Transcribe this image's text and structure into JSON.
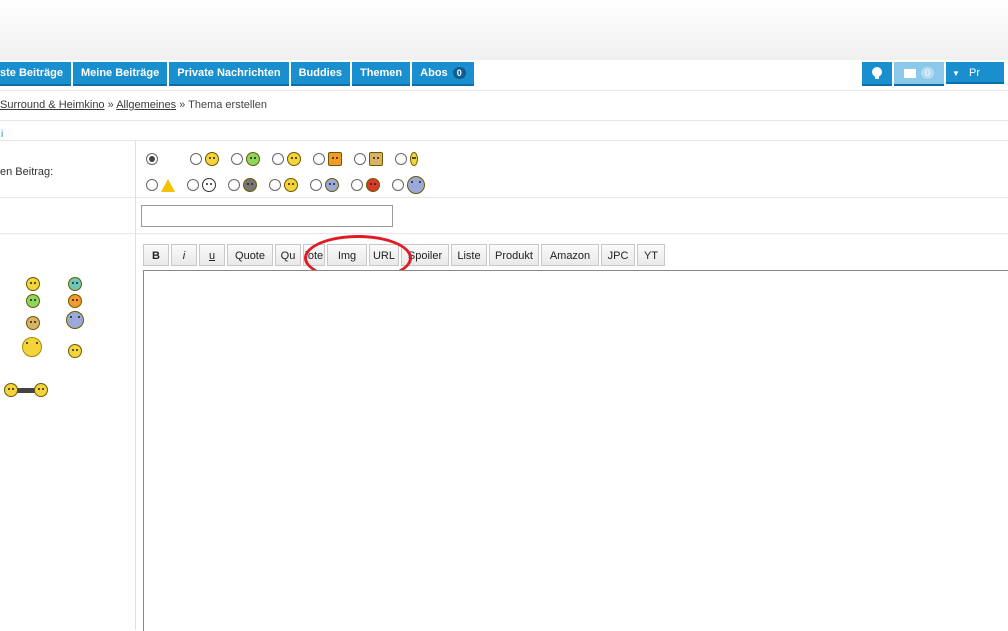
{
  "nav": {
    "tabs": [
      {
        "label": "ste Beiträge"
      },
      {
        "label": "Meine Beiträge"
      },
      {
        "label": "Private Nachrichten"
      },
      {
        "label": "Buddies"
      },
      {
        "label": "Themen"
      },
      {
        "label": "Abos",
        "badge": "0"
      }
    ],
    "right_label": "Pr",
    "right_badge": "0"
  },
  "breadcrumb": {
    "part1": "Surround & Heimkino",
    "sep1": " » ",
    "part2": "Allgemeines",
    "sep2": " » ",
    "current": "Thema erstellen"
  },
  "form": {
    "icon_label": "en Beitrag:",
    "title_value": ""
  },
  "toolbar": {
    "buttons": [
      "B",
      "i",
      "u",
      "Quote",
      "Qu",
      "[ote",
      "Img",
      "URL",
      "Spoiler",
      "Liste",
      "Produkt",
      "Amazon",
      "JPC",
      "YT"
    ]
  },
  "editor": {
    "value": ""
  },
  "colors": {
    "nav": "#1a8fcf",
    "annotation": "#e01b24"
  }
}
